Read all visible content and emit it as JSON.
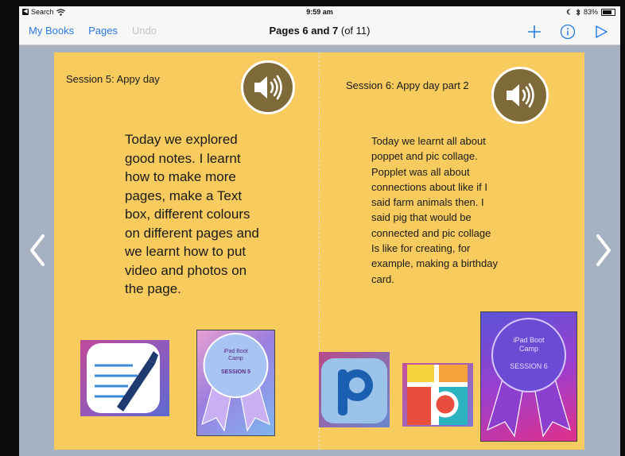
{
  "status_bar": {
    "back_label": "Search",
    "time": "9:59 am",
    "battery": "83%"
  },
  "nav": {
    "my_books": "My Books",
    "pages": "Pages",
    "undo": "Undo",
    "title_bold": "Pages 6 and 7",
    "title_rest": "(of 11)"
  },
  "left_page": {
    "session_title": "Session 5: Appy day",
    "body": "Today we explored good notes. I learnt how to make more pages, make a Text box, different colours on different pages and we learnt how to put video and photos on the page.",
    "badge_line1": "iPad Boot",
    "badge_line2": "Camp",
    "badge_line3": "SESSION 5"
  },
  "right_page": {
    "session_title": "Session 6: Appy day part 2",
    "body": "Today we learnt all about poppet  and pic collage. Popplet was all about connections about like if I said farm animals then. I said pig that would be connected and pic collage Is like for creating, for example, making a birthday card.",
    "badge_line1": "iPad Boot",
    "badge_line2": "Camp",
    "badge_line3": "SESSION 6"
  },
  "colors": {
    "page_background": "#f8cb5f",
    "speaker_fill": "#7f6a3a",
    "nav_accent": "#2a7ae2"
  }
}
